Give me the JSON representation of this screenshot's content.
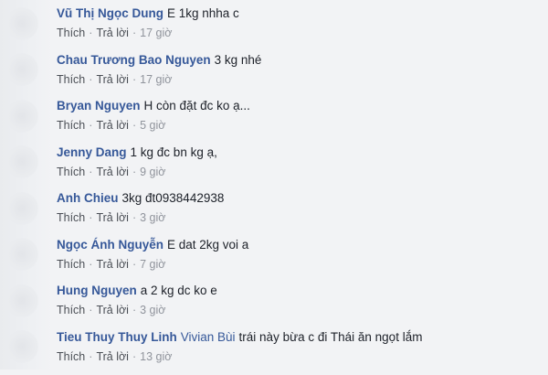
{
  "comments": [
    {
      "author": "Vũ Thị Ngọc Dung",
      "mention": "",
      "text": "E 1kg nhha c",
      "like": "Thích",
      "reply": "Trả lời",
      "sep": "·",
      "time": "17 giờ"
    },
    {
      "author": "Chau Trương Bao Nguyen",
      "mention": "",
      "text": "3 kg nhé",
      "like": "Thích",
      "reply": "Trả lời",
      "sep": "·",
      "time": "17 giờ"
    },
    {
      "author": "Bryan Nguyen",
      "mention": "",
      "text": "H còn đặt đc ko ạ...",
      "like": "Thích",
      "reply": "Trả lời",
      "sep": "·",
      "time": "5 giờ"
    },
    {
      "author": "Jenny Dang",
      "mention": "",
      "text": "1 kg đc bn kg ạ,",
      "like": "Thích",
      "reply": "Trả lời",
      "sep": "·",
      "time": "9 giờ"
    },
    {
      "author": "Anh Chieu",
      "mention": "",
      "text": "3kg đt0938442938",
      "like": "Thích",
      "reply": "Trả lời",
      "sep": "·",
      "time": "3 giờ"
    },
    {
      "author": "Ngọc Ánh Nguyễn",
      "mention": "",
      "text": "E dat 2kg voi a",
      "like": "Thích",
      "reply": "Trả lời",
      "sep": "·",
      "time": "7 giờ"
    },
    {
      "author": "Hung Nguyen",
      "mention": "",
      "text": "a 2 kg dc ko e",
      "like": "Thích",
      "reply": "Trả lời",
      "sep": "·",
      "time": "3 giờ"
    },
    {
      "author": "Tieu Thuy Thuy Linh",
      "mention": "Vivian Bùi",
      "text": "trái này bừa c đi Thái ăn ngọt lắm",
      "like": "Thích",
      "reply": "Trả lời",
      "sep": "·",
      "time": "13 giờ"
    }
  ]
}
